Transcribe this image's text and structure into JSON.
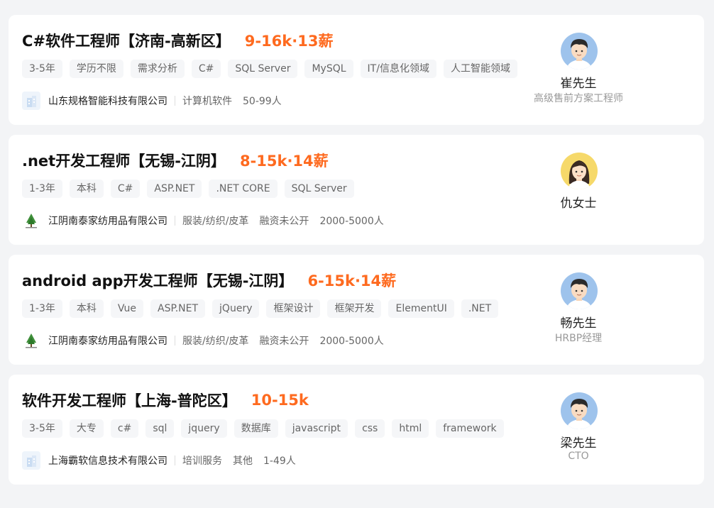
{
  "jobs": [
    {
      "title": "C#软件工程师【济南-高新区】",
      "salary": "9-16k·13薪",
      "tags": [
        "3-5年",
        "学历不限",
        "需求分析",
        "C#",
        "SQL Server",
        "MySQL",
        "IT/信息化领域",
        "人工智能领域"
      ],
      "company": {
        "name": "山东规格智能科技有限公司",
        "logo_icon": "building-icon",
        "meta": [
          "计算机软件",
          "50-99人"
        ]
      },
      "recruiter": {
        "name": "崔先生",
        "title": "高级售前方案工程师",
        "avatar_icon": "male-avatar-icon"
      }
    },
    {
      "title": ".net开发工程师【无锡-江阴】",
      "salary": "8-15k·14薪",
      "tags": [
        "1-3年",
        "本科",
        "C#",
        "ASP.NET",
        ".NET CORE",
        "SQL Server"
      ],
      "company": {
        "name": "江阴南泰家纺用品有限公司",
        "logo_icon": "tree-logo-icon",
        "meta": [
          "服装/纺织/皮革",
          "融资未公开",
          "2000-5000人"
        ]
      },
      "recruiter": {
        "name": "仇女士",
        "title": "",
        "avatar_icon": "female-avatar-icon"
      }
    },
    {
      "title": "android app开发工程师【无锡-江阴】",
      "salary": "6-15k·14薪",
      "tags": [
        "1-3年",
        "本科",
        "Vue",
        "ASP.NET",
        "jQuery",
        "框架设计",
        "框架开发",
        "ElementUI",
        ".NET"
      ],
      "company": {
        "name": "江阴南泰家纺用品有限公司",
        "logo_icon": "tree-logo-icon",
        "meta": [
          "服装/纺织/皮革",
          "融资未公开",
          "2000-5000人"
        ]
      },
      "recruiter": {
        "name": "畅先生",
        "title": "HRBP经理",
        "avatar_icon": "male-avatar-icon"
      }
    },
    {
      "title": "软件开发工程师【上海-普陀区】",
      "salary": "10-15k",
      "tags": [
        "3-5年",
        "大专",
        "c#",
        "sql",
        "jquery",
        "数据库",
        "javascript",
        "css",
        "html",
        "framework"
      ],
      "company": {
        "name": "上海霸软信息技术有限公司",
        "logo_icon": "building-icon",
        "meta": [
          "培训服务",
          "其他",
          "1-49人"
        ]
      },
      "recruiter": {
        "name": "梁先生",
        "title": "CTO",
        "avatar_icon": "male-avatar-icon"
      }
    }
  ],
  "colors": {
    "salary": "#fe6a1f",
    "tag_bg": "#f5f6f8",
    "page_bg": "#f3f4f6"
  }
}
